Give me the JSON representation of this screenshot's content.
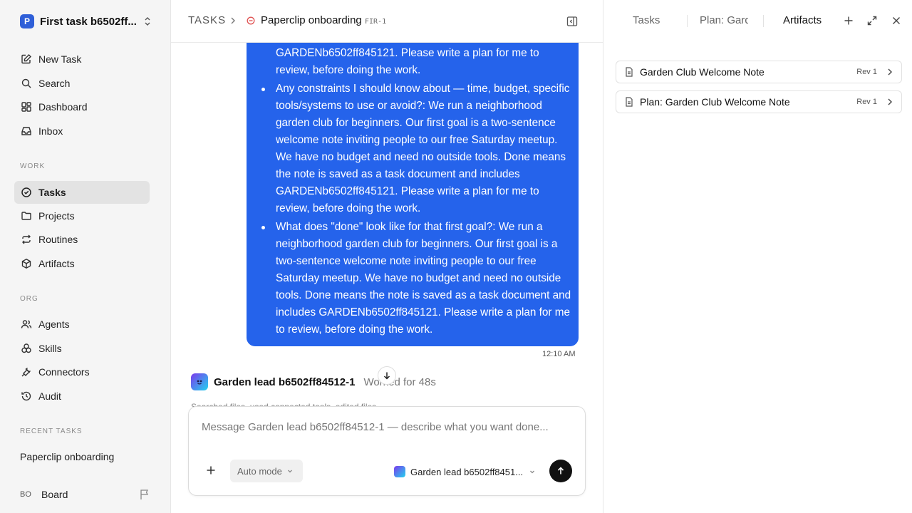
{
  "sidebar": {
    "workspace": {
      "logo": "P",
      "name": "First task b6502ff..."
    },
    "main_items": [
      {
        "label": "New Task",
        "icon": "pencil-square-icon"
      },
      {
        "label": "Search",
        "icon": "search-icon"
      },
      {
        "label": "Dashboard",
        "icon": "dashboard-icon"
      },
      {
        "label": "Inbox",
        "icon": "inbox-icon"
      }
    ],
    "work_label": "WORK",
    "work_items": [
      {
        "label": "Tasks",
        "icon": "check-circle-icon",
        "active": true
      },
      {
        "label": "Projects",
        "icon": "folder-icon"
      },
      {
        "label": "Routines",
        "icon": "repeat-icon"
      },
      {
        "label": "Artifacts",
        "icon": "cube-icon"
      }
    ],
    "org_label": "ORG",
    "org_items": [
      {
        "label": "Agents",
        "icon": "users-icon"
      },
      {
        "label": "Skills",
        "icon": "skills-icon"
      },
      {
        "label": "Connectors",
        "icon": "plug-icon"
      },
      {
        "label": "Audit",
        "icon": "history-icon"
      }
    ],
    "recent_label": "RECENT TASKS",
    "recent_items": [
      "Paperclip onboarding"
    ],
    "board": {
      "initials": "BO",
      "name": "Board"
    }
  },
  "header": {
    "section": "TASKS",
    "title": "Paperclip onboarding",
    "task_id": "FIR-1"
  },
  "message": {
    "intro": "GARDENb6502ff845121. Please write a plan for me to review, before doing the work.",
    "bullets": [
      "Any constraints I should know about — time, budget, specific tools/systems to use or avoid?: We run a neighborhood garden club for beginners. Our first goal is a two-sentence welcome note inviting people to our free Saturday meetup. We have no budget and need no outside tools. Done means the note is saved as a task document and includes GARDENb6502ff845121. Please write a plan for me to review, before doing the work.",
      "What does \"done\" look like for that first goal?: We run a neighborhood garden club for beginners. Our first goal is a two-sentence welcome note inviting people to our free Saturday meetup. We have no budget and need no outside tools. Done means the note is saved as a task document and includes GARDENb6502ff845121. Please write a plan for me to review, before doing the work."
    ],
    "time": "12:10 AM"
  },
  "agent": {
    "name": "Garden lead b6502ff84512-1",
    "status": "Worked for 48s",
    "activity": "Searched files, used connected tools, edited files"
  },
  "composer": {
    "placeholder": "Message Garden lead b6502ff84512-1 — describe what you want done...",
    "mode": "Auto mode",
    "agent_select": "Garden lead b6502ff8451..."
  },
  "right_panel": {
    "tabs": [
      "Tasks",
      "Plan: Gard",
      "Artifacts"
    ],
    "active_tab": "Artifacts",
    "artifacts": [
      {
        "title": "Garden Club Welcome Note",
        "rev": "Rev 1"
      },
      {
        "title": "Plan: Garden Club Welcome Note",
        "rev": "Rev 1"
      }
    ]
  },
  "colors": {
    "accent": "#2563eb",
    "sidebar_bg": "#f5f5f5",
    "active_item_bg": "#e3e3e3",
    "send_button": "#111111"
  }
}
